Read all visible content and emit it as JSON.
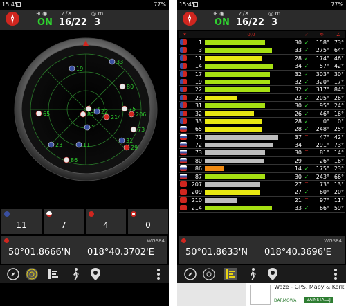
{
  "left": {
    "status": {
      "time": "15:45",
      "battery": "77%"
    },
    "header": {
      "fix_label": "ON",
      "sats_label": "16/22",
      "meters_label": "3"
    },
    "counts": [
      {
        "flag": "us",
        "value": "11"
      },
      {
        "flag": "ru",
        "value": "7"
      },
      {
        "flag": "cn",
        "value": "4"
      },
      {
        "flag": "jp",
        "value": "0"
      }
    ],
    "coords": {
      "lat": "50°01.8666'N",
      "lon": "018°40.3702'E",
      "datum": "WGS84"
    },
    "sky_labels": [
      "19",
      "33",
      "80",
      "75",
      "65",
      "72",
      "22",
      "87",
      "214",
      "206",
      "73",
      "1",
      "31",
      "29",
      "23",
      "11",
      "86"
    ]
  },
  "right": {
    "status": {
      "time": "15:45",
      "battery": "77%"
    },
    "header": {
      "fix_label": "ON",
      "sats_label": "16/22",
      "meters_label": "3"
    },
    "table_headers": {
      "snr_icon": "0,0",
      "used_icon": "✓"
    },
    "rows": [
      {
        "flag": "us",
        "id": "1",
        "snr": "30",
        "used": "✓",
        "az": "158°",
        "el": "73°",
        "bar": 0.74,
        "color": "#a6e012"
      },
      {
        "flag": "us",
        "id": "3",
        "snr": "33",
        "used": "✓",
        "az": "275°",
        "el": "64°",
        "bar": 0.82,
        "color": "#a6e012"
      },
      {
        "flag": "us",
        "id": "11",
        "snr": "28",
        "used": "✓",
        "az": "174°",
        "el": "46°",
        "bar": 0.7,
        "color": "#e8e812"
      },
      {
        "flag": "us",
        "id": "14",
        "snr": "34",
        "used": "✓",
        "az": "57°",
        "el": "42°",
        "bar": 0.84,
        "color": "#a6e012"
      },
      {
        "flag": "us",
        "id": "17",
        "snr": "32",
        "used": "✓",
        "az": "303°",
        "el": "30°",
        "bar": 0.8,
        "color": "#a6e012"
      },
      {
        "flag": "us",
        "id": "19",
        "snr": "32",
        "used": "✓",
        "az": "320°",
        "el": "17°",
        "bar": 0.8,
        "color": "#a6e012"
      },
      {
        "flag": "us",
        "id": "22",
        "snr": "32",
        "used": "✓",
        "az": "317°",
        "el": "84°",
        "bar": 0.8,
        "color": "#a6e012"
      },
      {
        "flag": "us",
        "id": "23",
        "snr": "23",
        "used": "✓",
        "az": "205°",
        "el": "26°",
        "bar": 0.4,
        "color": "#e8e812"
      },
      {
        "flag": "us",
        "id": "31",
        "snr": "30",
        "used": "✓",
        "az": "95°",
        "el": "24°",
        "bar": 0.74,
        "color": "#a6e012"
      },
      {
        "flag": "us",
        "id": "32",
        "snr": "26",
        "used": "✓",
        "az": "46°",
        "el": "16°",
        "bar": 0.6,
        "color": "#e8e812"
      },
      {
        "flag": "us",
        "id": "33",
        "snr": "28",
        "used": "✓",
        "az": "0°",
        "el": "0°",
        "bar": 0.7,
        "color": "#e8e812"
      },
      {
        "flag": "ru",
        "id": "65",
        "snr": "28",
        "used": "✓",
        "az": "248°",
        "el": "25°",
        "bar": 0.7,
        "color": "#e8e812"
      },
      {
        "flag": "ru",
        "id": "71",
        "snr": "37",
        "used": "‾",
        "az": "47°",
        "el": "42°",
        "bar": 0.9,
        "color": "#bdbdbd"
      },
      {
        "flag": "ru",
        "id": "72",
        "snr": "34",
        "used": "‾",
        "az": "291°",
        "el": "73°",
        "bar": 0.84,
        "color": "#bdbdbd"
      },
      {
        "flag": "ru",
        "id": "73",
        "snr": "30",
        "used": "‾",
        "az": "81°",
        "el": "14°",
        "bar": 0.74,
        "color": "#bdbdbd"
      },
      {
        "flag": "ru",
        "id": "80",
        "snr": "29",
        "used": "‾",
        "az": "26°",
        "el": "16°",
        "bar": 0.72,
        "color": "#bdbdbd"
      },
      {
        "flag": "ru",
        "id": "86",
        "snr": "14",
        "used": "✓",
        "az": "175°",
        "el": "23°",
        "bar": 0.24,
        "color": "#f08a12"
      },
      {
        "flag": "ru",
        "id": "87",
        "snr": "30",
        "used": "✓",
        "az": "243°",
        "el": "66°",
        "bar": 0.74,
        "color": "#a6e012"
      },
      {
        "flag": "cn",
        "id": "207",
        "snr": "27",
        "used": "‾",
        "az": "73°",
        "el": "13°",
        "bar": 0.68,
        "color": "#bdbdbd"
      },
      {
        "flag": "cn",
        "id": "209",
        "snr": "27",
        "used": "✓",
        "az": "60°",
        "el": "20°",
        "bar": 0.68,
        "color": "#e8e812"
      },
      {
        "flag": "cn",
        "id": "210",
        "snr": "21",
        "used": "‾",
        "az": "97°",
        "el": "11°",
        "bar": 0.4,
        "color": "#bdbdbd"
      },
      {
        "flag": "cn",
        "id": "214",
        "snr": "33",
        "used": "✓",
        "az": "66°",
        "el": "59°",
        "bar": 0.82,
        "color": "#a6e012"
      }
    ],
    "coords": {
      "lat": "50°01.8633'N",
      "lon": "018°40.3696'E",
      "datum": "WGS84"
    },
    "ad": {
      "title": "Waze - GPS, Mapy & Korki",
      "free": "DARMOWA",
      "install": "ZAINSTALUJ"
    }
  }
}
